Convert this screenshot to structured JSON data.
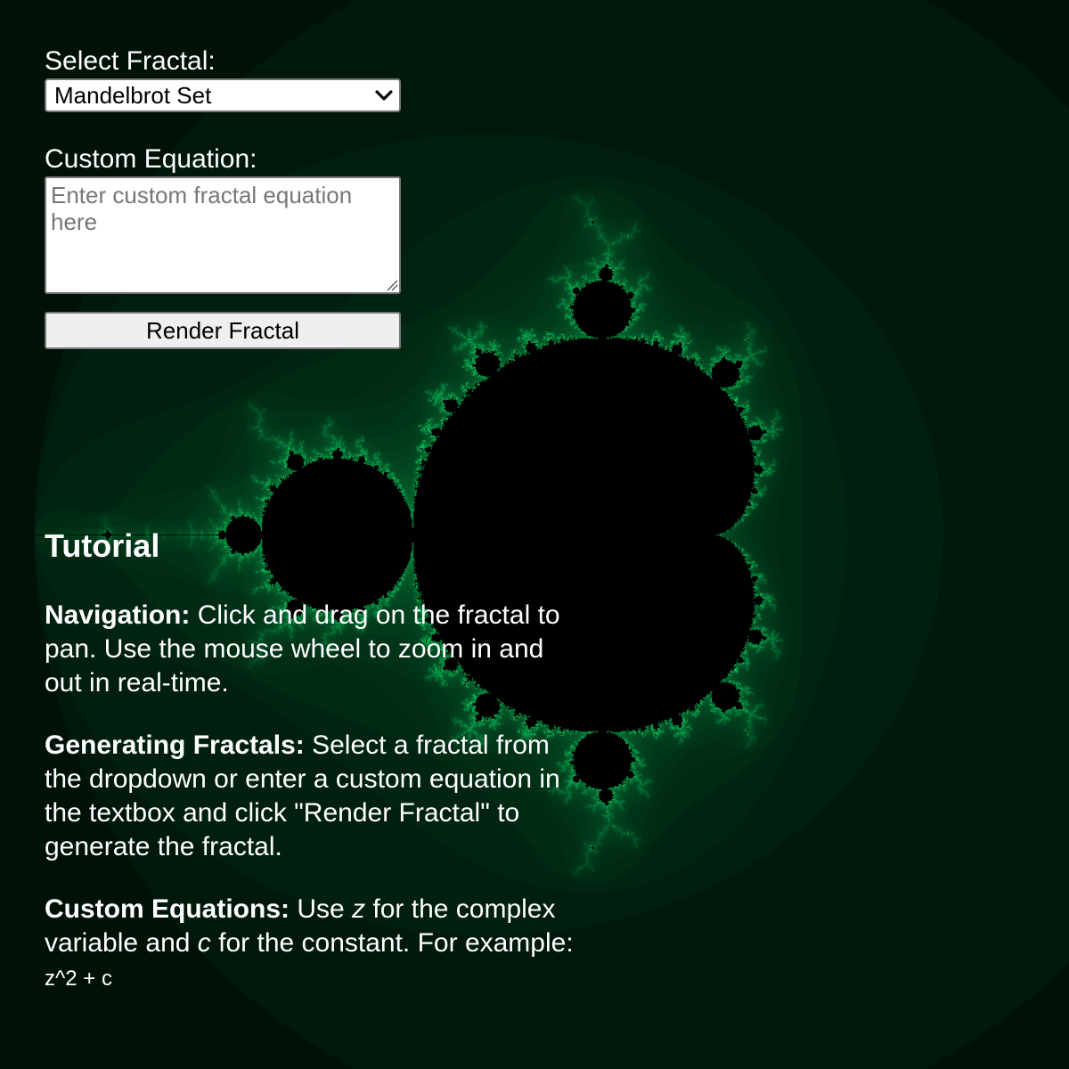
{
  "controls": {
    "select_label": "Select Fractal:",
    "selected_fractal": "Mandelbrot Set",
    "equation_label": "Custom Equation:",
    "equation_value": "",
    "equation_placeholder": "Enter custom fractal equation here",
    "render_button": "Render Fractal"
  },
  "tutorial": {
    "title": "Tutorial",
    "navigation": {
      "heading": "Navigation:",
      "text": "Click and drag on the fractal to pan. Use the mouse wheel to zoom in and out in real-time."
    },
    "generating": {
      "heading": "Generating Fractals:",
      "text": "Select a fractal from the dropdown or enter a custom equation in the textbox and click \"Render Fractal\" to generate the fractal."
    },
    "custom": {
      "heading": "Custom Equations:",
      "text_1": "Use",
      "var_z": "z",
      "text_2": "for the complex variable and",
      "var_c": "c",
      "text_3": "for the constant. For example:",
      "example": "z^2 + c"
    }
  },
  "colors": {
    "background": "#000000",
    "fractal_edge": "#35d67a",
    "text": "#ffffff"
  }
}
